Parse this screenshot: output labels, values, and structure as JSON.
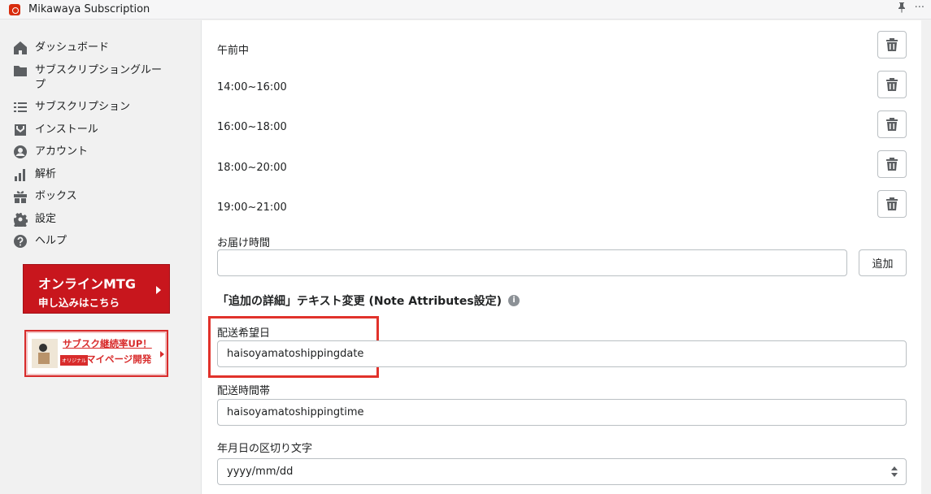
{
  "app": {
    "title": "Mikawaya Subscription",
    "more_glyph": "···"
  },
  "sidebar": {
    "items": [
      {
        "label": "ダッシュボード",
        "icon": "home-icon"
      },
      {
        "label": "サブスクリプショングループ",
        "icon": "folder-icon"
      },
      {
        "label": "サブスクリプション",
        "icon": "list-icon"
      },
      {
        "label": "インストール",
        "icon": "install-icon"
      },
      {
        "label": "アカウント",
        "icon": "account-icon"
      },
      {
        "label": "解析",
        "icon": "analytics-icon"
      },
      {
        "label": "ボックス",
        "icon": "gift-icon"
      },
      {
        "label": "設定",
        "icon": "gear-icon"
      },
      {
        "label": "ヘルプ",
        "icon": "help-icon"
      }
    ],
    "banner_meeting": {
      "line1": "オンラインMTG",
      "line2": "申し込みはこちら"
    },
    "banner_mypage": {
      "line1": "サブスク継続率UP！",
      "tag": "オリジナル",
      "line2": "マイページ開発"
    }
  },
  "time_slots": [
    "午前中",
    "14:00~16:00",
    "16:00~18:00",
    "18:00~20:00",
    "19:00~21:00"
  ],
  "delivery_time": {
    "label": "お届け時間",
    "value": "",
    "add_label": "追加"
  },
  "note_attributes": {
    "heading": "「追加の詳細」テキスト変更 (Note Attributes設定)",
    "info_glyph": "i",
    "date_label": "配送希望日",
    "date_value": "haisoyamatoshippingdate",
    "time_label": "配送時間帯",
    "time_value": "haisoyamatoshippingtime",
    "separator_label": "年月日の区切り文字",
    "separator_value": "yyyy/mm/dd"
  },
  "colors": {
    "highlight": "#e1322b",
    "banner_red": "#c8161d"
  }
}
